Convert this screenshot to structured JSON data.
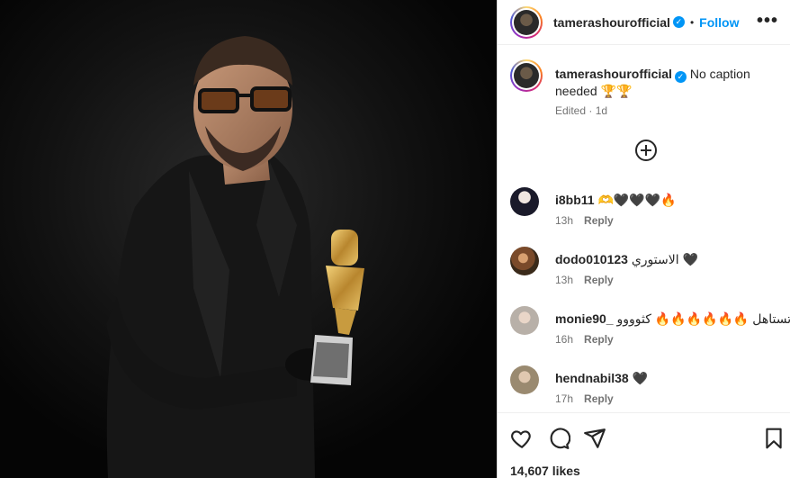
{
  "post": {
    "username": "tamerashourofficial",
    "verified_mark": "✓",
    "separator": "•",
    "follow_label": "Follow",
    "more_icon": "•••"
  },
  "caption": {
    "username": "tamerashourofficial",
    "text": "No caption needed 🏆🏆",
    "edited": "Edited · 1d"
  },
  "comments": [
    {
      "user": "i8bb11",
      "text": "🫶🖤🖤🖤🔥",
      "time": "13h",
      "reply": "Reply"
    },
    {
      "user": "dodo010123",
      "text": "الاستوري 🖤",
      "time": "13h",
      "reply": "Reply"
    },
    {
      "user": "monie90_",
      "text": "تستاهل 🔥🔥🔥🔥🔥🔥 كثوووو",
      "time": "16h",
      "reply": "Reply"
    },
    {
      "user": "hendnabil38",
      "text": "🖤",
      "time": "17h",
      "reply": "Reply"
    }
  ],
  "likes": "14,607 likes",
  "colors": {
    "accent": "#0095f6",
    "text": "#262626",
    "muted": "#737373"
  },
  "icons": [
    "heart-icon",
    "comment-icon",
    "share-icon",
    "bookmark-icon",
    "add-comment-icon"
  ]
}
